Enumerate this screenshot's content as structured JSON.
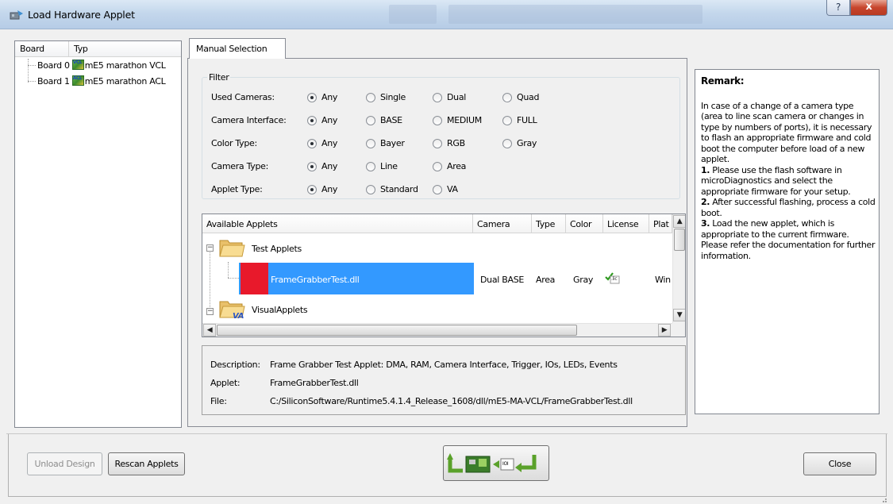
{
  "window": {
    "title": "Load Hardware Applet",
    "help_glyph": "?",
    "close_glyph": "x"
  },
  "boards": {
    "columns": [
      "Board",
      "Typ"
    ],
    "items": [
      {
        "label": "Board 0",
        "chip_badge": "VCL",
        "type": "mE5 marathon VCL"
      },
      {
        "label": "Board 1",
        "chip_badge": "ACL",
        "type": "mE5 marathon ACL"
      }
    ]
  },
  "tab": {
    "label": "Manual Selection"
  },
  "filter": {
    "legend": "Filter",
    "rows": [
      {
        "label": "Used Cameras:",
        "options": [
          "Any",
          "Single",
          "Dual",
          "Quad"
        ],
        "selected": "Any"
      },
      {
        "label": "Camera Interface:",
        "options": [
          "Any",
          "BASE",
          "MEDIUM",
          "FULL"
        ],
        "selected": "Any"
      },
      {
        "label": "Color Type:",
        "options": [
          "Any",
          "Bayer",
          "RGB",
          "Gray"
        ],
        "selected": "Any"
      },
      {
        "label": "Camera Type:",
        "options": [
          "Any",
          "Line",
          "Area"
        ],
        "selected": "Any"
      },
      {
        "label": "Applet Type:",
        "options": [
          "Any",
          "Standard",
          "VA"
        ],
        "selected": "Any"
      }
    ]
  },
  "applets_table": {
    "columns": [
      "Available Applets",
      "Camera",
      "Type",
      "Color",
      "License",
      "Plat"
    ],
    "groups": [
      {
        "name": "Test Applets"
      },
      {
        "name": "VisualApplets",
        "badge": "VA"
      }
    ],
    "selected_row": {
      "name": "FrameGrabberTest.dll",
      "camera": "Dual BASE",
      "type": "Area",
      "color": "Gray",
      "license_icon": "license-check-icon",
      "license_text": ".lic",
      "platform": "Win"
    }
  },
  "description": {
    "description_label": "Description:",
    "description_value": "Frame Grabber Test Applet: DMA, RAM, Camera Interface, Trigger, IOs, LEDs, Events",
    "applet_label": "Applet:",
    "applet_value": "FrameGrabberTest.dll",
    "file_label": "File:",
    "file_value": "C:/SiliconSoftware/Runtime5.4.1.4_Release_1608/dll/mE5-MA-VCL/FrameGrabberTest.dll"
  },
  "remark": {
    "title": "Remark:",
    "intro": "In case of a change of a camera type (area to line scan camera or changes in type by numbers of ports), it is necessary to flash an appropriate firmware and cold boot the computer before load of a new applet.",
    "steps": [
      {
        "num": "1.",
        "text": "Please use the flash software in microDiagnostics and select the appropriate firmware for your setup."
      },
      {
        "num": "2.",
        "text": "After successful flashing, process a cold boot."
      },
      {
        "num": "3.",
        "text": "Load the new applet, which is appropriate to the current firmware. Please refer the documentation for further information."
      }
    ]
  },
  "buttons": {
    "unload": "Unload Design",
    "rescan": "Rescan Applets",
    "load_icon_chip_label": "IOI",
    "close": "Close"
  },
  "colors": {
    "selection": "#3399ff",
    "applet_swatch": "#e8192b",
    "title_bar": "#c4d7ec"
  }
}
